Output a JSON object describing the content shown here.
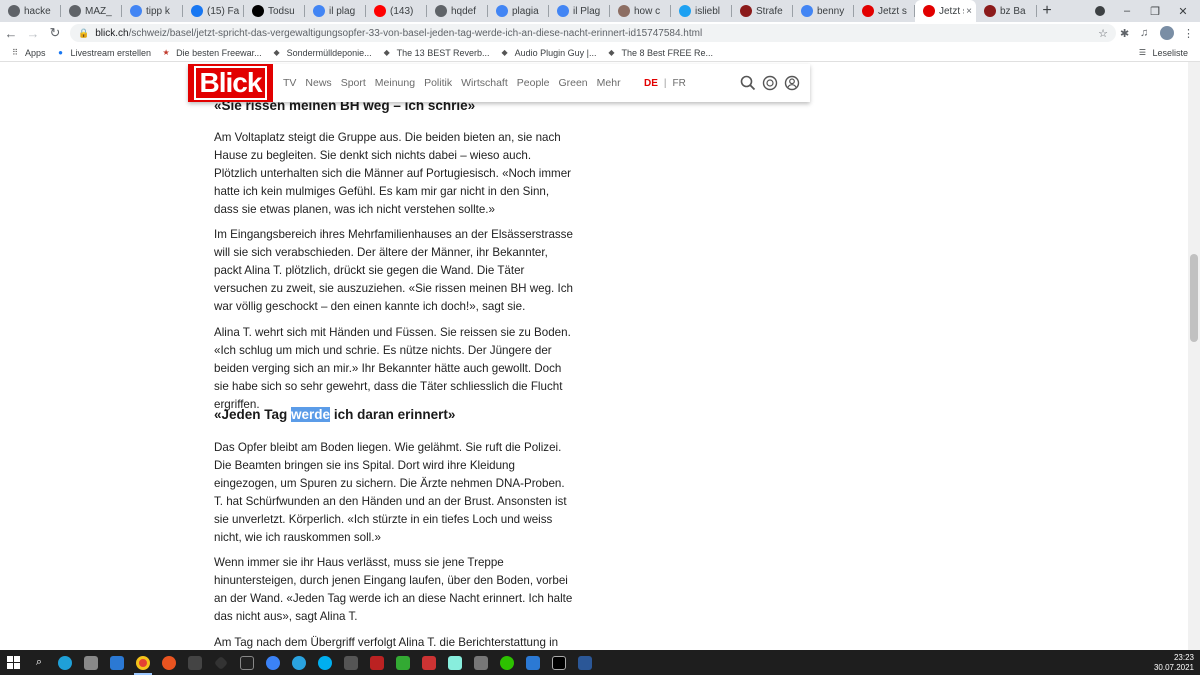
{
  "browser": {
    "tabs": [
      {
        "label": "hacke",
        "icon": "globe-icon",
        "color": "#5f6368"
      },
      {
        "label": "MAZ_",
        "icon": "globe-icon",
        "color": "#5f6368"
      },
      {
        "label": "tipp k",
        "icon": "google-icon",
        "color": "#4285f4"
      },
      {
        "label": "(15) Fa",
        "icon": "facebook-icon",
        "color": "#1877f2"
      },
      {
        "label": "Todsu",
        "icon": "wikipedia-icon",
        "color": "#000000"
      },
      {
        "label": "il plag",
        "icon": "google-icon",
        "color": "#4285f4"
      },
      {
        "label": "(143)",
        "icon": "youtube-icon",
        "color": "#ff0000"
      },
      {
        "label": "hqdef",
        "icon": "globe-icon",
        "color": "#5f6368"
      },
      {
        "label": "plagia",
        "icon": "google-icon",
        "color": "#4285f4"
      },
      {
        "label": "il Plag",
        "icon": "google-icon",
        "color": "#4285f4"
      },
      {
        "label": "how c",
        "icon": "page-icon",
        "color": "#8d6e63"
      },
      {
        "label": "isliebl",
        "icon": "twitter-icon",
        "color": "#1da1f2"
      },
      {
        "label": "Strafe",
        "icon": "bz-icon",
        "color": "#8b1a1a"
      },
      {
        "label": "benny",
        "icon": "google-icon",
        "color": "#4285f4"
      },
      {
        "label": "Jetzt s",
        "icon": "blick-icon",
        "color": "#e20000"
      },
      {
        "label": "Jetzt s",
        "icon": "blick-icon",
        "color": "#e20000",
        "active": true
      },
      {
        "label": "bz Ba",
        "icon": "bz-icon",
        "color": "#8b1a1a"
      }
    ],
    "url_host": "blick.ch",
    "url_path": "/schweiz/basel/jetzt-spricht-das-vergewaltigungsopfer-33-von-basel-jeden-tag-werde-ich-an-diese-nacht-erinnert-id15747584.html",
    "bookmarks": [
      {
        "label": "Apps",
        "icon": "apps-grid-icon"
      },
      {
        "label": "Livestream erstellen",
        "icon": "facebook-icon"
      },
      {
        "label": "Die besten Freewar...",
        "icon": "star-icon"
      },
      {
        "label": "Sondermülldeponie...",
        "icon": "page-icon"
      },
      {
        "label": "The 13 BEST Reverb...",
        "icon": "page-icon"
      },
      {
        "label": "Audio Plugin Guy |...",
        "icon": "page-icon"
      },
      {
        "label": "The 8 Best FREE Re...",
        "icon": "page-icon"
      }
    ],
    "reading_list": "Leseliste"
  },
  "site": {
    "logo": "Blick",
    "nav": [
      "TV",
      "News",
      "Sport",
      "Meinung",
      "Politik",
      "Wirtschaft",
      "People",
      "Green",
      "Mehr"
    ],
    "lang_active": "DE",
    "lang_other": "FR"
  },
  "article": {
    "h1": "«Sie rissen meinen BH weg – ich schrie»",
    "p1": "Am Voltaplatz steigt die Gruppe aus. Die beiden bieten an, sie nach Hause zu begleiten. Sie denkt sich nichts dabei – wieso auch. Plötzlich unterhalten sich die Männer auf Portugiesisch. «Noch immer hatte ich kein mulmiges Gefühl. Es kam mir gar nicht in den Sinn, dass sie etwas planen, was ich nicht verstehen sollte.»",
    "p2": "Im Eingangsbereich ihres Mehrfamilienhauses an der Elsässerstrasse will sie sich verabschieden. Der ältere der Männer, ihr Bekannter, packt Alina T. plötzlich, drückt sie gegen die Wand. Die Täter versuchen zu zweit, sie auszuziehen. «Sie rissen meinen BH weg. Ich war völlig geschockt – den einen kannte ich doch!», sagt sie.",
    "p3": "Alina T. wehrt sich mit Händen und Füssen. Sie reissen sie zu Boden. «Ich schlug um mich und schrie. Es nütze nichts. Der Jüngere der beiden verging sich an mir.» Ihr Bekannter hätte auch gewollt. Doch sie habe sich so sehr gewehrt, dass die Täter schliesslich die Flucht ergriffen.",
    "h2_before": "«Jeden Tag ",
    "h2_highlight": "werde",
    "h2_after": " ich daran erinnert»",
    "p4": "Das Opfer bleibt am Boden liegen. Wie gelähmt. Sie ruft die Polizei. Die Beamten bringen sie ins Spital. Dort wird ihre Kleidung eingezogen, um Spuren zu sichern. Die Ärzte nehmen DNA-Proben. T. hat Schürfwunden an den Händen und an der Brust. Ansonsten ist sie unverletzt. Körperlich. «Ich stürzte in ein tiefes Loch und weiss nicht, wie ich rauskommen soll.»",
    "p5": "Wenn immer sie ihr Haus verlässt, muss sie jene Treppe hinuntersteigen, durch jenen Eingang laufen, über den Boden, vorbei an der Wand. «Jeden Tag werde ich an diese Nacht erinnert. Ich halte das nicht aus», sagt Alina T.",
    "p6": "Am Tag nach dem Übergriff verfolgt Alina T. die Berichterstattung in"
  },
  "taskbar": {
    "time": "23:23",
    "date": "30.07.2021"
  },
  "colors": {
    "brand": "#e20000",
    "highlight": "#5b9ce8"
  }
}
